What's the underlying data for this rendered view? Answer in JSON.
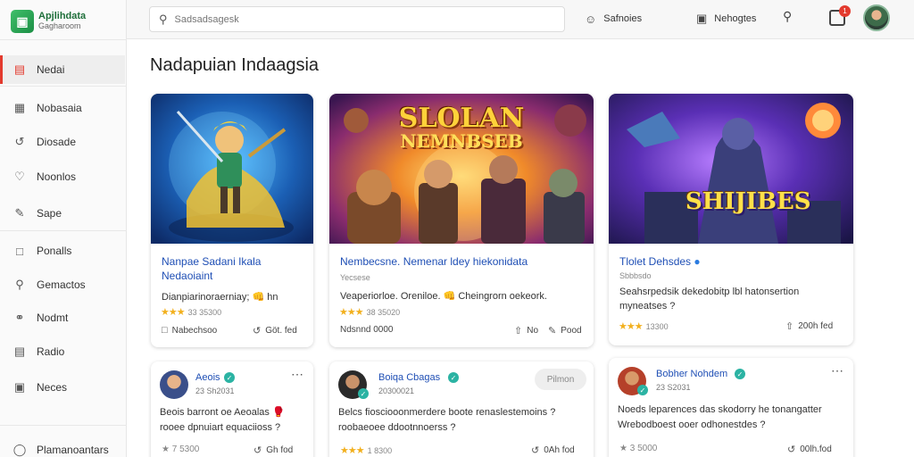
{
  "app": {
    "logo_title": "Apjlihdata",
    "logo_subtitle": "Gagharoom",
    "logo_icon": "cube-icon"
  },
  "sidebar": {
    "items": [
      {
        "label": "Nedai",
        "icon": "store-icon",
        "active": true
      },
      {
        "label": "Nobasaia",
        "icon": "image-icon",
        "active": false
      },
      {
        "label": "Diosade",
        "icon": "share-icon",
        "active": false
      },
      {
        "label": "Noonlos",
        "icon": "heart-icon",
        "active": false
      },
      {
        "label": "Sape",
        "icon": "pencil-icon",
        "active": false
      },
      {
        "label": "Ponalls",
        "icon": "chart-icon",
        "active": false
      },
      {
        "label": "Gemactos",
        "icon": "search-icon",
        "active": false
      },
      {
        "label": "Nodmt",
        "icon": "users-icon",
        "active": false
      },
      {
        "label": "Radio",
        "icon": "list-icon",
        "active": false
      },
      {
        "label": "Neces",
        "icon": "doc-icon",
        "active": false
      },
      {
        "label": "Plamanoantars",
        "icon": "location-icon",
        "active": false
      }
    ]
  },
  "header": {
    "search_placeholder": "Sadsadsagesk",
    "btn1_label": "Safnoies",
    "btn2_label": "Nehogtes",
    "notif_count": "1"
  },
  "main": {
    "page_title": "Nadapuian Indaagsia",
    "cards": [
      {
        "title_line1": "Nanpae Sadani Ikala",
        "title_line2": "Nedaoiaint",
        "meta": "Dianpiarinoraerniay; 👊 hn",
        "stars": "★★★",
        "rating_count": "33 35300",
        "foot_left": "Nabechsoo",
        "foot_right": "Göt. fed"
      },
      {
        "title_line1": "Nembecsne. Nemenar ldey hiekonidata",
        "meta_line1": "Yecsese",
        "meta_line2": "Veaperiorloe. Oreniloe. 👊 Cheingrorn oekeork.",
        "stars": "★★★",
        "rating_count": "38 35020",
        "foot_left": "Ndsnnd 0000",
        "foot_mid": "No",
        "foot_right": "Pood",
        "banner_line1": "SLOLAN",
        "banner_line2": "NEMNBSEB"
      },
      {
        "title_line1": "Tlolet Dehsdes",
        "meta_line1": "Sbbbsdo",
        "meta_line2": "Seahsrpedsik dekedobitp lbl hatonsertion",
        "meta_line3": "myneatses ?",
        "stars": "★★★",
        "rating_count": "13300",
        "foot_right": "200h fed",
        "banner_text": "SHIJIBES"
      }
    ],
    "posts": [
      {
        "name": "Aeois",
        "time": "23 Sh2031",
        "text_line1": "Beois barront oe Aeoalas 🥊",
        "text_line2": "rooee dpnuiart equaciioss ?",
        "stars": "★ 7 5300",
        "foot_right": "Gh fod"
      },
      {
        "name": "Boiqa Cbagas",
        "time": "20300021",
        "follow": "Pilmon",
        "text_line1": "Belcs fiosciooonmerdere boote renaslestemoins ?",
        "text_line2": "roobaeoee ddootnnoerss ?",
        "stars": "★★★",
        "rating_count": "1 8300",
        "foot_right": "0Ah fod"
      },
      {
        "name": "Bobher Nohdem",
        "time": "23 S2031",
        "text_line1": "Noeds leparences das skodorry he tonangatter",
        "text_line2": "Wrebodboest ooer odhonestdes ?",
        "stars": "★ 3 5000",
        "foot_right": "00lh.fod"
      }
    ]
  },
  "colors": {
    "accent": "#e33a2e",
    "link": "#1f4fb5",
    "star": "#f2b01e",
    "verified": "#2bb3a3"
  }
}
